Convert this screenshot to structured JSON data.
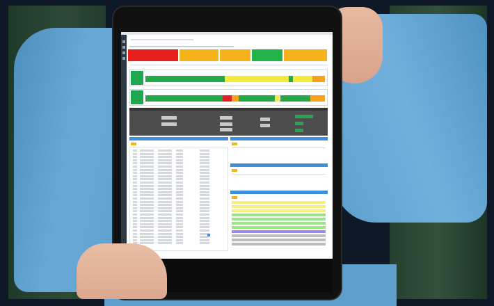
{
  "scene": {
    "description_label": "",
    "device": "tablet",
    "colors": {
      "shirt": "#5f9fcc",
      "background_green": "#2e4a37",
      "frame": "#0f1826",
      "status_red": "#e82020",
      "status_green": "#25b24a",
      "status_amber": "#f5b21a",
      "bar_green": "#25a847",
      "bar_yellow": "#f3ea3a",
      "bar_orange": "#f7a21a",
      "bar_red": "#e22222",
      "table_yellow": "#f7f07a",
      "table_green": "#9be58a",
      "table_purple": "#9d8cf0",
      "table_gray": "#bdbdbd",
      "panel_blue": "#3f8fd9",
      "dark_panel": "#4d4d4d"
    }
  },
  "dashboard": {
    "status_tiles": [
      {
        "color": "#e82020"
      },
      {
        "color": "#f5b21a"
      },
      {
        "color": "#f5b21a"
      },
      {
        "color": "#25b24a"
      },
      {
        "color": "#f5b21a"
      }
    ],
    "timeline_bars": [
      {
        "segments": [
          {
            "color": "#25a847",
            "start": 0.0,
            "end": 0.44
          },
          {
            "color": "#f3ea3a",
            "start": 0.44,
            "end": 0.8
          },
          {
            "color": "#25a847",
            "start": 0.8,
            "end": 0.82
          },
          {
            "color": "#f3ea3a",
            "start": 0.82,
            "end": 0.93
          },
          {
            "color": "#f7a21a",
            "start": 0.93,
            "end": 1.0
          }
        ]
      },
      {
        "segments": [
          {
            "color": "#25a847",
            "start": 0.0,
            "end": 0.43
          },
          {
            "color": "#e22222",
            "start": 0.43,
            "end": 0.48
          },
          {
            "color": "#f7a21a",
            "start": 0.48,
            "end": 0.52
          },
          {
            "color": "#25a847",
            "start": 0.52,
            "end": 0.58
          },
          {
            "color": "#25a847",
            "start": 0.58,
            "end": 0.72
          },
          {
            "color": "#f3ea3a",
            "start": 0.72,
            "end": 0.75
          },
          {
            "color": "#25a847",
            "start": 0.75,
            "end": 0.92
          },
          {
            "color": "#f7a21a",
            "start": 0.92,
            "end": 1.0
          }
        ]
      }
    ],
    "right_table_rows": [
      "#f7f07a",
      "#f7f07a",
      "#f7f07a",
      "#9be58a",
      "#9be58a",
      "#9be58a",
      "#9be58a",
      "#9d8cf0",
      "#bdbdbd",
      "#bdbdbd",
      "#bdbdbd"
    ],
    "left_table_row_count": 30
  }
}
